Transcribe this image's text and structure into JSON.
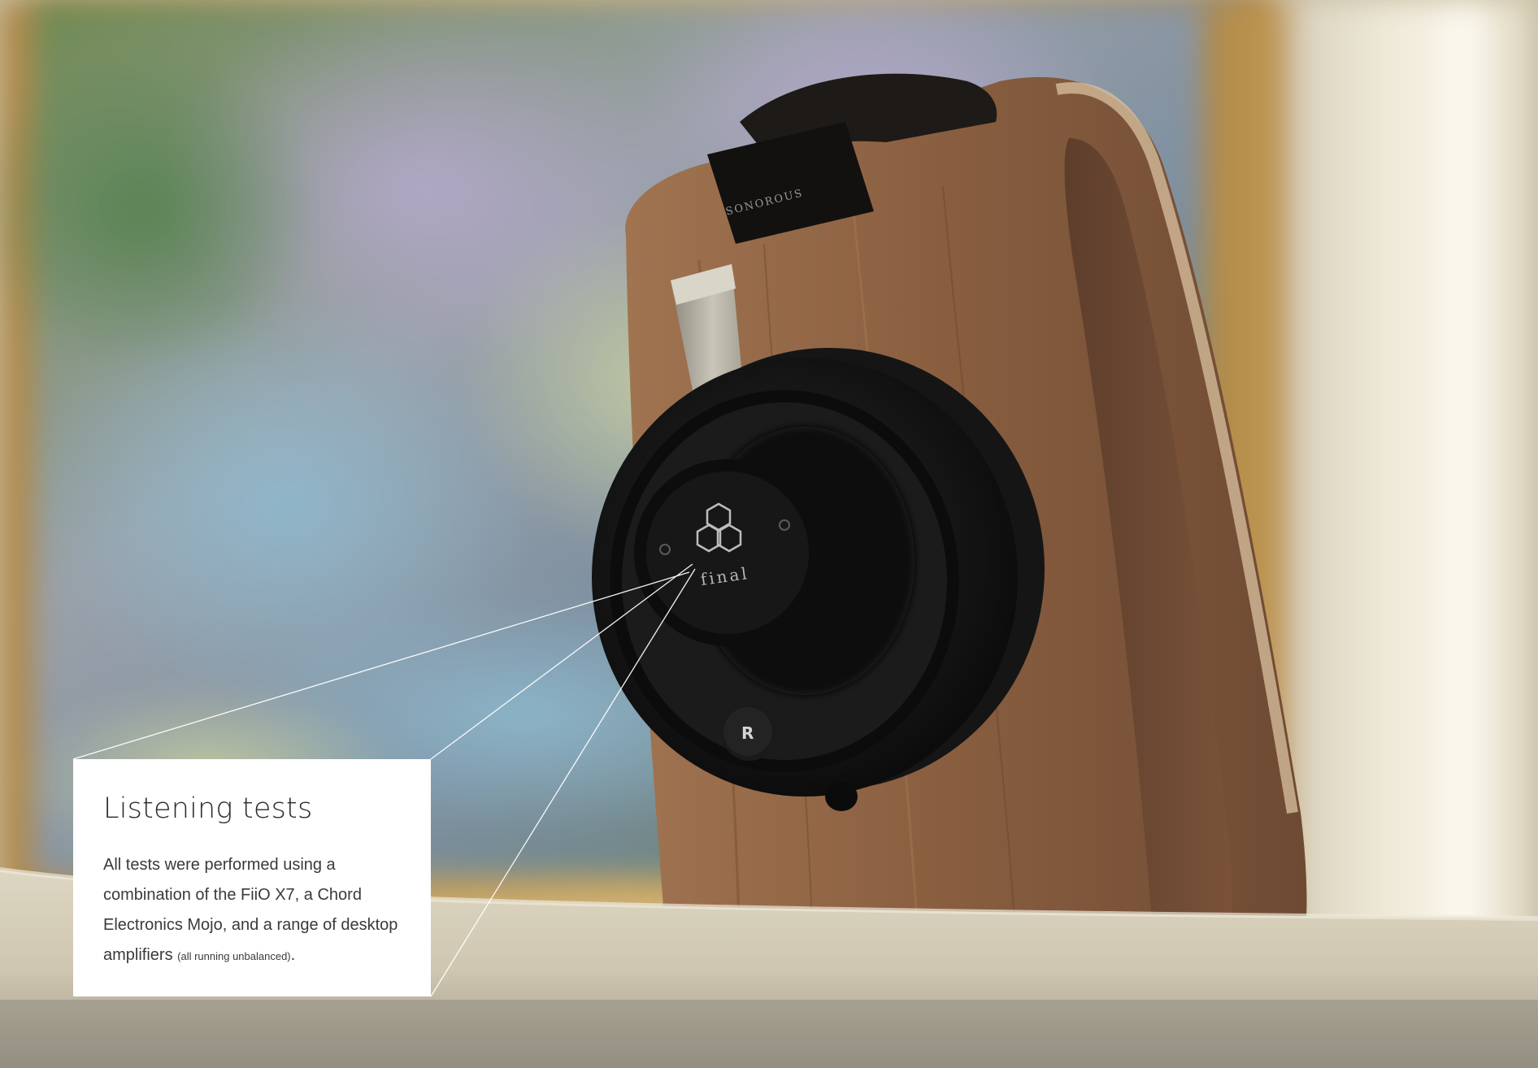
{
  "photo": {
    "headband_brand": "SONOROUS",
    "cup_logo": "final",
    "channel_marker": "R"
  },
  "callout": {
    "title": "Listening tests",
    "body_main": "All tests were performed using a combination of the FiiO X7, a Chord Electronics Mojo, and a range of desktop amplifiers ",
    "body_note": "(all running unbalanced)",
    "body_end": "."
  },
  "colors": {
    "panel_background": "#ffffff",
    "leader_line": "#ffffff",
    "title_text": "#2b2b2b",
    "body_text": "#3a3a3a"
  }
}
